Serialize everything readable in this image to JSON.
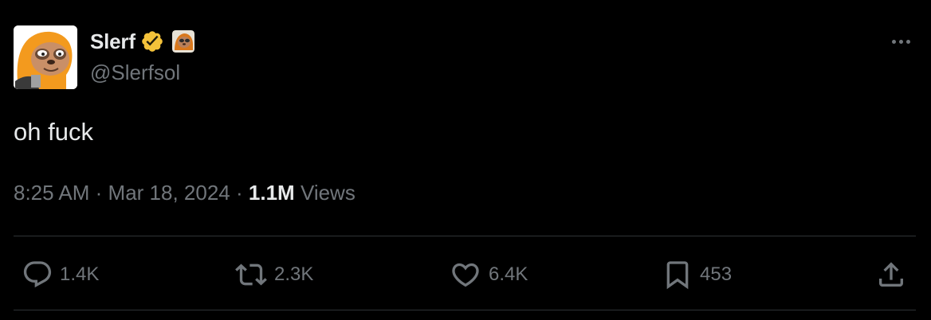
{
  "user": {
    "display_name": "Slerf",
    "handle": "@Slerfsol",
    "verified": true,
    "verified_color": "#f4c23a",
    "avatar_icon": "sloth-avatar",
    "affiliate_badge_icon": "affiliate-badge"
  },
  "tweet": {
    "text": "oh fuck",
    "time": "8:25 AM",
    "date": "Mar 18, 2024",
    "separator": "·",
    "views_count": "1.1M",
    "views_label": "Views"
  },
  "actions": {
    "reply": {
      "icon": "reply-icon",
      "count": "1.4K"
    },
    "retweet": {
      "icon": "retweet-icon",
      "count": "2.3K"
    },
    "like": {
      "icon": "heart-icon",
      "count": "6.4K"
    },
    "bookmark": {
      "icon": "bookmark-icon",
      "count": "453"
    },
    "share": {
      "icon": "share-icon"
    }
  },
  "colors": {
    "background": "#000000",
    "primary_text": "#e7e9ea",
    "secondary_text": "#71767b",
    "divider": "#2f3336"
  }
}
